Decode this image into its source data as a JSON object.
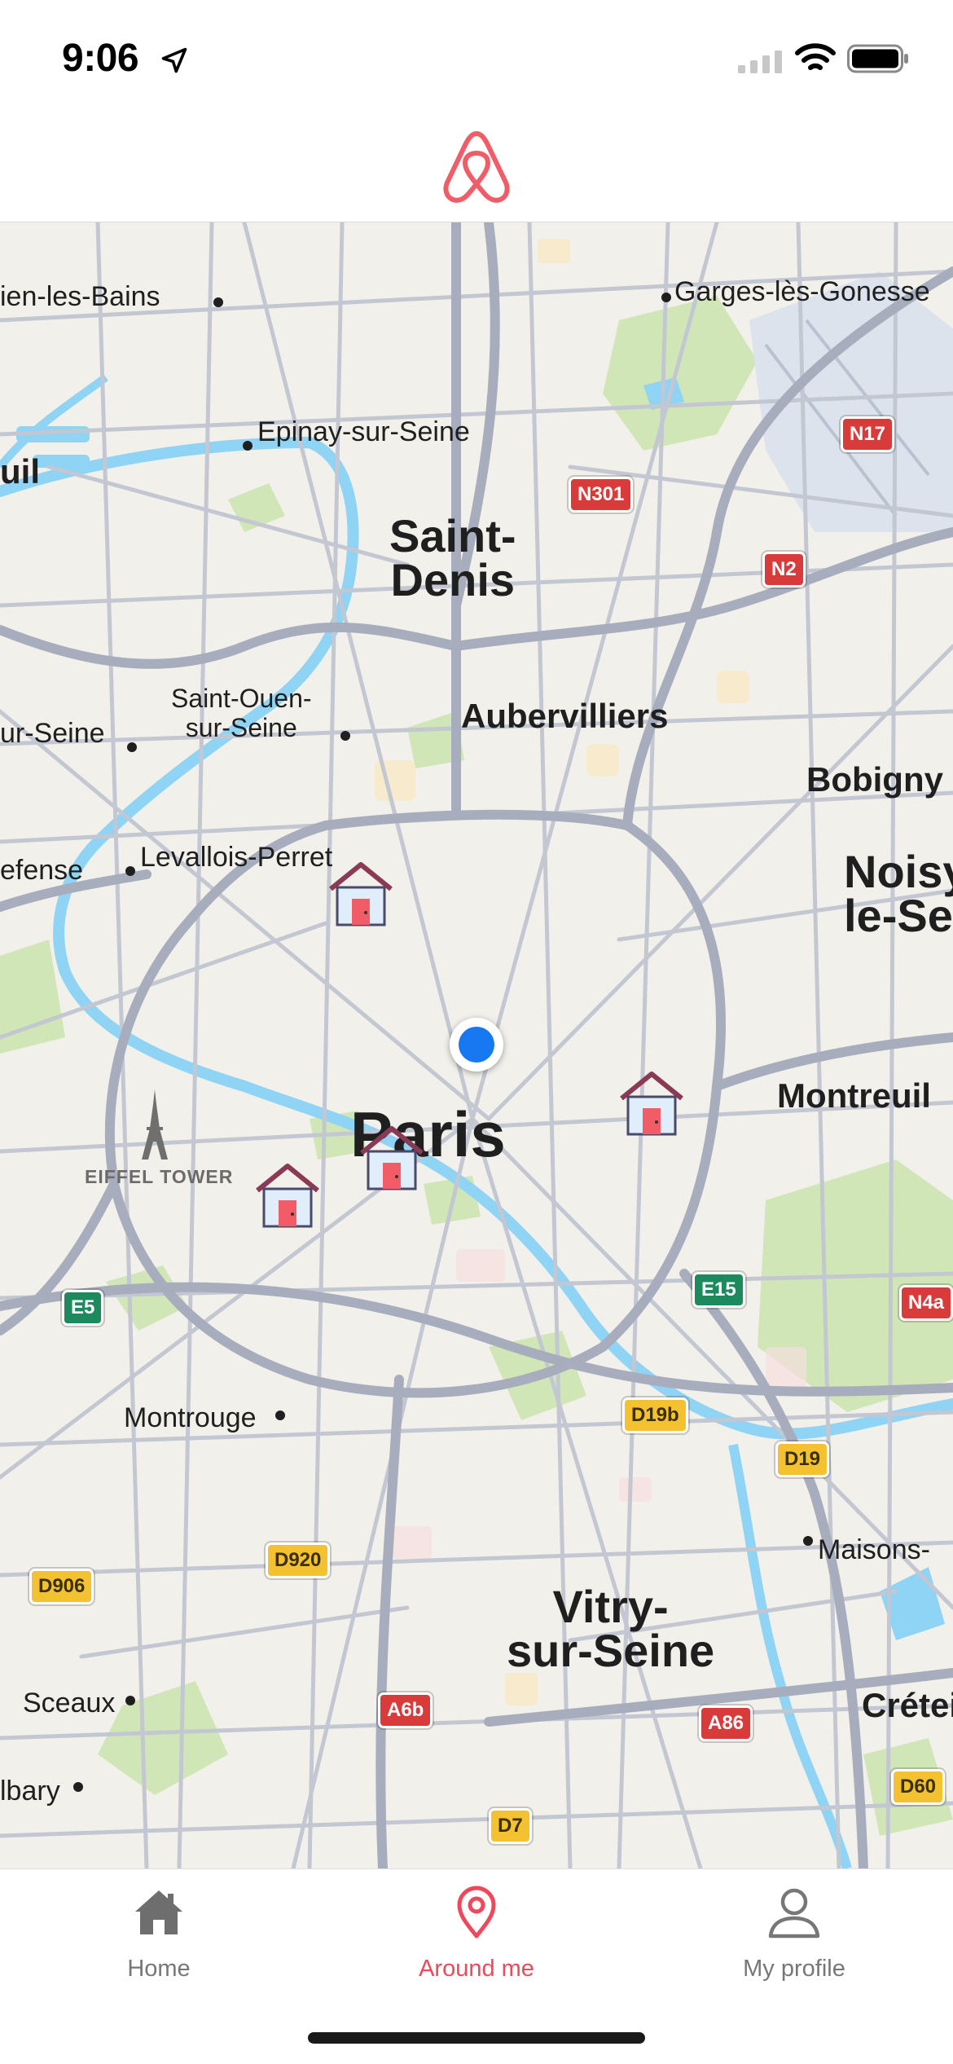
{
  "status_bar": {
    "time": "9:06",
    "icons": [
      "location-arrow-icon",
      "signal-icon",
      "wifi-icon",
      "battery-icon"
    ]
  },
  "header": {
    "logo": "airbnb-logo",
    "accent_color": "#f25c67"
  },
  "map": {
    "center_label": "Paris",
    "places": {
      "garges": "Garges-lès-Gonesse",
      "enghien": "ien-les-Bains",
      "epinay": "Epinay-sur-Seine",
      "uil": "uil",
      "saint_denis": "Saint-\nDenis",
      "saint_ouen": "Saint-Ouen-\nsur-Seine",
      "ur_seine": "ur-Seine",
      "aubervilliers": "Aubervilliers",
      "bobigny": "Bobigny",
      "noisy": "Noisy\nle-Se",
      "efense": "efense",
      "levallois": "Levallois-Perret",
      "montreuil": "Montreuil",
      "montrouge": "Montrouge",
      "maisons": "Maisons-",
      "vitry": "Vitry-\nsur-Seine",
      "sceaux": "Sceaux",
      "creteil": "Crétei",
      "lbary": "lbary"
    },
    "landmark": "EIFFEL TOWER",
    "road_shields": {
      "n17": "N17",
      "n301": "N301",
      "n2": "N2",
      "e5": "E5",
      "e15": "E15",
      "n4a": "N4a",
      "d19b": "D19b",
      "d19": "D19",
      "d906": "D906",
      "d920": "D920",
      "a6b": "A6b",
      "a86": "A86",
      "d60": "D60",
      "d7": "D7"
    },
    "listing_pin_count": 4,
    "user_location": "current-location"
  },
  "tab_bar": {
    "tabs": [
      {
        "id": "home",
        "label": "Home",
        "icon": "house-icon",
        "active": false
      },
      {
        "id": "around_me",
        "label": "Around me",
        "icon": "map-pin-icon",
        "active": true
      },
      {
        "id": "my_profile",
        "label": "My profile",
        "icon": "person-icon",
        "active": false
      }
    ],
    "active_color": "#f0485b",
    "inactive_color": "#777777"
  }
}
